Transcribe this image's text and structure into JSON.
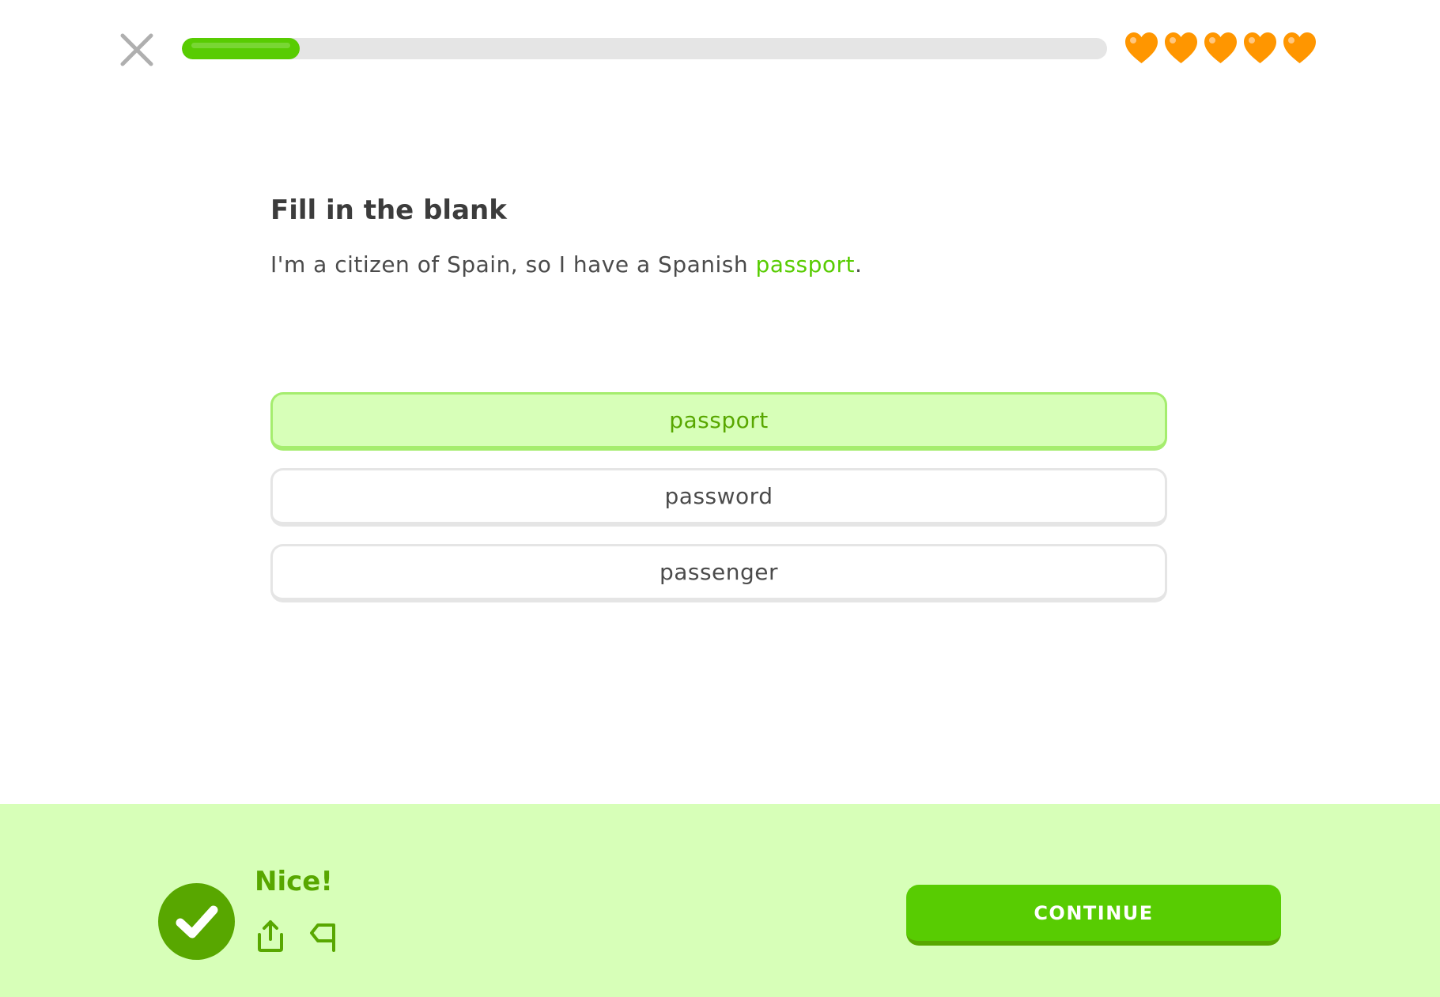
{
  "header": {
    "progress_fraction": 0.127,
    "hearts_count": 5,
    "heart_color": "#ff9600",
    "close_icon": "close-icon"
  },
  "question": {
    "instruction": "Fill in the blank",
    "sentence_before": "I'm a citizen of Spain, so I have a Spanish ",
    "sentence_answer": "passport",
    "sentence_after": "."
  },
  "options": [
    {
      "label": "passport",
      "selected": true
    },
    {
      "label": "password",
      "selected": false
    },
    {
      "label": "passenger",
      "selected": false
    }
  ],
  "feedback": {
    "title": "Nice!",
    "status": "correct",
    "accent_color": "#58a700",
    "background_color": "#d7ffb8",
    "share_icon": "share-icon",
    "report_icon": "flag-icon",
    "continue_label": "CONTINUE"
  }
}
